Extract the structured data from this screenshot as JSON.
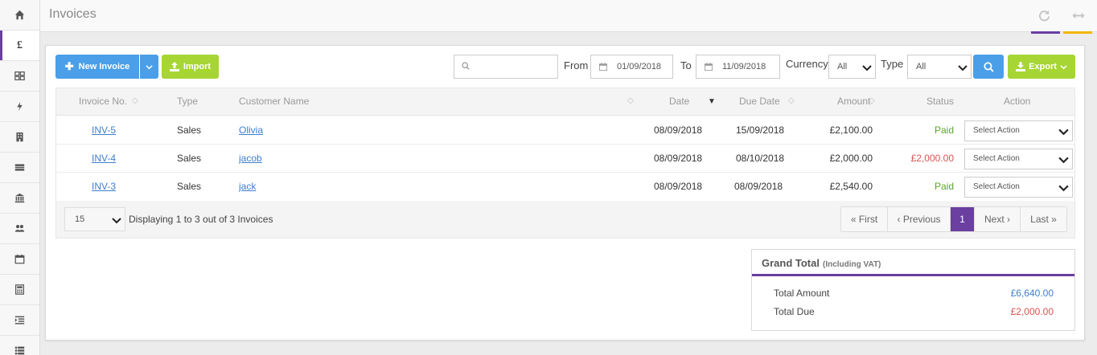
{
  "page": {
    "title": "Invoices"
  },
  "sidebar": {
    "items": [
      {
        "icon": "home-icon"
      },
      {
        "icon": "pound-icon",
        "glyph": "£",
        "active": true
      },
      {
        "icon": "grid-icon"
      },
      {
        "icon": "bolt-icon"
      },
      {
        "icon": "building-icon"
      },
      {
        "icon": "card-icon"
      },
      {
        "icon": "bank-icon"
      },
      {
        "icon": "users-icon"
      },
      {
        "icon": "calendar-icon"
      },
      {
        "icon": "calculator-icon"
      },
      {
        "icon": "indent-icon"
      },
      {
        "icon": "list-icon"
      }
    ]
  },
  "toolbar": {
    "new_invoice": "New Invoice",
    "import": "Import",
    "search_placeholder": "",
    "from_label": "From",
    "from_date": "01/09/2018",
    "to_label": "To",
    "to_date": "11/09/2018",
    "currency_label": "Currency",
    "currency_value": "All",
    "type_label": "Type",
    "type_value": "All",
    "export": "Export"
  },
  "table": {
    "headers": {
      "invoice_no": "Invoice No.",
      "type": "Type",
      "customer": "Customer Name",
      "date": "Date",
      "due_date": "Due Date",
      "amount": "Amount",
      "status": "Status",
      "action": "Action"
    },
    "rows": [
      {
        "invoice_no": "INV-5",
        "type": "Sales",
        "customer": "Olivia",
        "date": "08/09/2018",
        "due_date": "15/09/2018",
        "amount": "£2,100.00",
        "status": "Paid",
        "status_kind": "paid",
        "action": "Select Action"
      },
      {
        "invoice_no": "INV-4",
        "type": "Sales",
        "customer": "jacob",
        "date": "08/09/2018",
        "due_date": "08/10/2018",
        "amount": "£2,000.00",
        "status": "£2,000.00",
        "status_kind": "due",
        "action": "Select Action"
      },
      {
        "invoice_no": "INV-3",
        "type": "Sales",
        "customer": "jack",
        "date": "08/09/2018",
        "due_date": "08/09/2018",
        "amount": "£2,540.00",
        "status": "Paid",
        "status_kind": "paid",
        "action": "Select Action"
      }
    ]
  },
  "footer": {
    "page_size": "15",
    "info": "Displaying 1 to 3 out of 3 Invoices",
    "pager": {
      "first": "« First",
      "previous": "‹ Previous",
      "current": "1",
      "next": "Next ›",
      "last": "Last »"
    }
  },
  "grand_total": {
    "title": "Grand Total",
    "subtitle": "(Including VAT)",
    "total_amount_label": "Total Amount",
    "total_amount_value": "£6,640.00",
    "total_due_label": "Total Due",
    "total_due_value": "£2,000.00"
  },
  "colors": {
    "accent_purple": "#6a3fa0",
    "accent_yellow": "#f2b705",
    "button_blue": "#4a9fe8",
    "button_green": "#a6d534",
    "paid_green": "#5aa728",
    "due_red": "#d9534f",
    "link_blue": "#3e7fcf"
  }
}
